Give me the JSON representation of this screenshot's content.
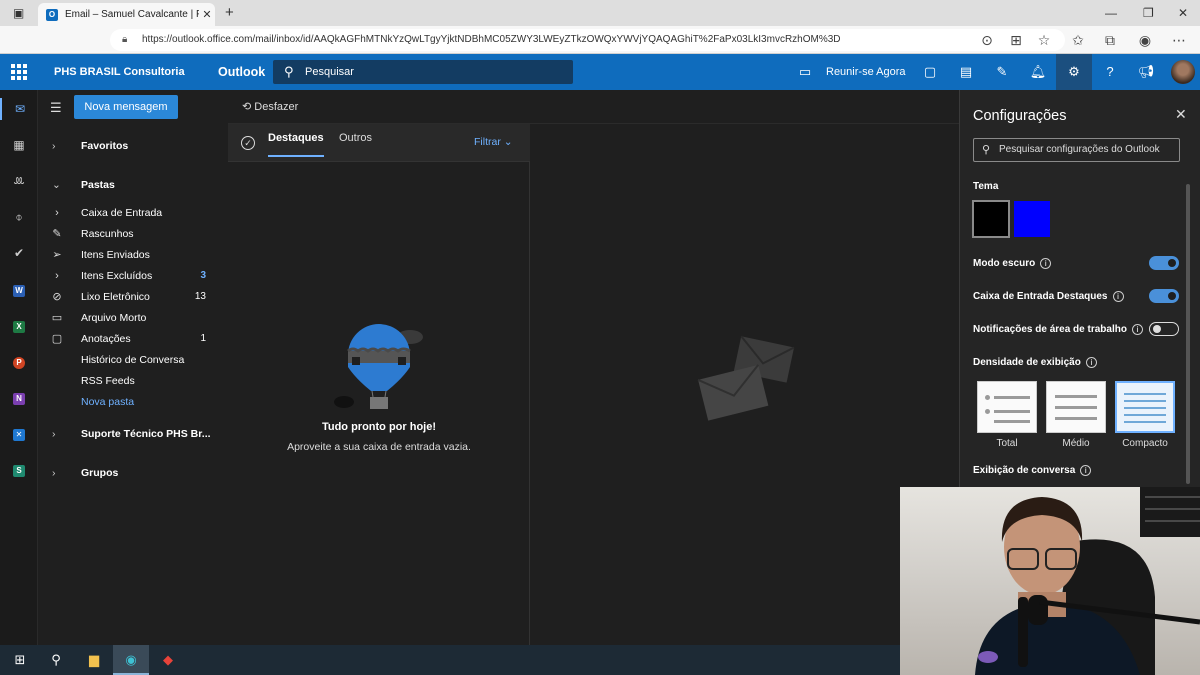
{
  "browser": {
    "tab_title": "Email – Samuel Cavalcante | PHS",
    "url": "https://outlook.office.com/mail/inbox/id/AAQkAGFhMTNkYzQwLTgyYjktNDBhMC05ZWY3LWEyZTkzOWQxYWVjYQAQAGhiT%2FaPx03LkI3mvcRzhOM%3D"
  },
  "header": {
    "org_name": "PHS BRASIL Consultoria",
    "app_name": "Outlook",
    "search_placeholder": "Pesquisar",
    "meet_now": "Reunir-se Agora"
  },
  "folder_pane": {
    "new_message": "Nova mensagem",
    "favorites": "Favoritos",
    "folders": "Pastas",
    "items": [
      {
        "label": "Caixa de Entrada",
        "count": "",
        "icon": "chevron-right-icon"
      },
      {
        "label": "Rascunhos",
        "count": "",
        "icon": "pencil-icon"
      },
      {
        "label": "Itens Enviados",
        "count": "",
        "icon": "send-icon"
      },
      {
        "label": "Itens Excluídos",
        "count": "3",
        "icon": "chevron-right-icon"
      },
      {
        "label": "Lixo Eletrônico",
        "count": "13",
        "icon": "blocked-icon"
      },
      {
        "label": "Arquivo Morto",
        "count": "",
        "icon": "archive-icon"
      },
      {
        "label": "Anotações",
        "count": "1",
        "icon": "note-icon"
      },
      {
        "label": "Histórico de Conversa",
        "count": "",
        "icon": ""
      },
      {
        "label": "RSS Feeds",
        "count": "",
        "icon": ""
      },
      {
        "label": "Nova pasta",
        "count": "",
        "icon": ""
      }
    ],
    "group_support": "Suporte Técnico PHS Br...",
    "groups": "Grupos"
  },
  "command_bar": {
    "undo": "Desfazer"
  },
  "message_list": {
    "tab_focused": "Destaques",
    "tab_other": "Outros",
    "filter": "Filtrar",
    "empty_title": "Tudo pronto por hoje!",
    "empty_subtitle": "Aproveite a sua caixa de entrada vazia."
  },
  "settings": {
    "title": "Configurações",
    "search_placeholder": "Pesquisar configurações do Outlook",
    "theme_label": "Tema",
    "theme_swatches": [
      "#000000",
      "#0000ff"
    ],
    "dark_mode": "Modo escuro",
    "focused_inbox": "Caixa de Entrada Destaques",
    "desktop_notifications": "Notificações de área de trabalho",
    "display_density": "Densidade de exibição",
    "density_options": [
      "Total",
      "Médio",
      "Compacto"
    ],
    "conversation_view": "Exibição de conversa",
    "toggles": {
      "dark_mode": true,
      "focused_inbox": true,
      "desktop_notifications": false
    }
  },
  "colors": {
    "accent": "#0f6cbd",
    "link": "#6fb1ff"
  }
}
